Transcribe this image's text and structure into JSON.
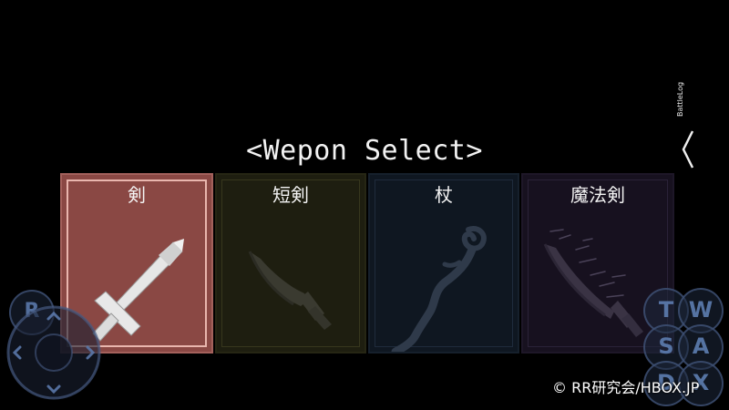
{
  "screen": {
    "title": "<Wepon Select>"
  },
  "weapons": [
    {
      "label": "剣",
      "icon": "sword-icon",
      "selected": true
    },
    {
      "label": "短剣",
      "icon": "dagger-icon",
      "selected": false
    },
    {
      "label": "杖",
      "icon": "staff-icon",
      "selected": false
    },
    {
      "label": "魔法剣",
      "icon": "magic-sword-icon",
      "selected": false
    }
  ],
  "battlelog": {
    "label": "BattleLog",
    "icon": "chevron-left-icon"
  },
  "controls": {
    "left_button": "R",
    "dpad_icon": "dpad-icon",
    "action_buttons": [
      "T",
      "W",
      "S",
      "A",
      "D",
      "X"
    ]
  },
  "copyright": "© RR研究会/HBOX.JP",
  "colors": {
    "background": "#000000",
    "selected_card": "#8a4844",
    "dagger_card": "#1e1e10",
    "staff_card": "#0f1721",
    "magic_card": "#17111f"
  }
}
